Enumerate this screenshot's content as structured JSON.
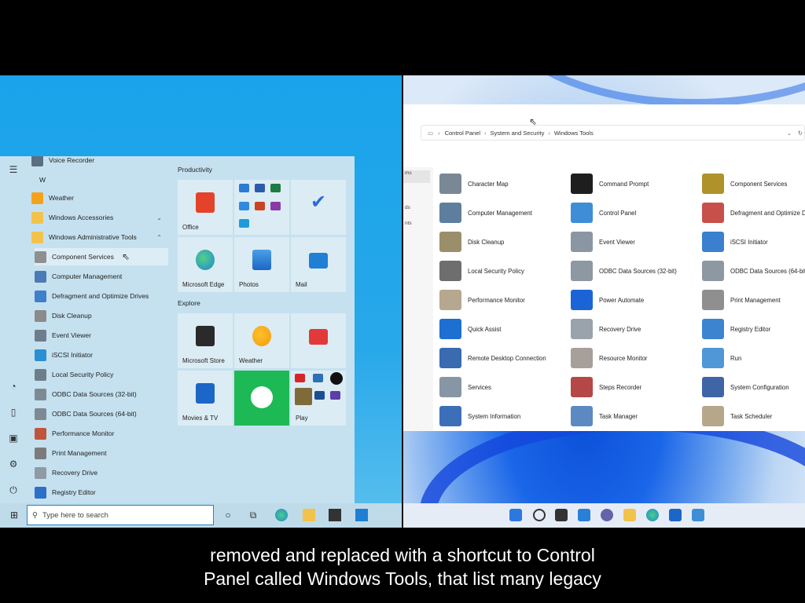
{
  "win10": {
    "app_list": {
      "top_item": "Voice Recorder",
      "letter": "W",
      "items": [
        {
          "label": "Weather",
          "color": "#f3a21c"
        },
        {
          "label": "Windows Accessories",
          "color": "#f2c34b"
        },
        {
          "label": "Windows Administrative Tools",
          "color": "#f2c34b"
        }
      ],
      "admin_tools": [
        {
          "label": "Component Services",
          "color": "#8f8f8f"
        },
        {
          "label": "Computer Management",
          "color": "#4a7bb5"
        },
        {
          "label": "Defragment and Optimize Drives",
          "color": "#3f7fcb"
        },
        {
          "label": "Disk Cleanup",
          "color": "#8b8b8b"
        },
        {
          "label": "Event Viewer",
          "color": "#6e7d8c"
        },
        {
          "label": "iSCSI Initiator",
          "color": "#2c8fd1"
        },
        {
          "label": "Local Security Policy",
          "color": "#6d7e8a"
        },
        {
          "label": "ODBC Data Sources (32-bit)",
          "color": "#7d8a94"
        },
        {
          "label": "ODBC Data Sources (64-bit)",
          "color": "#7d8a94"
        },
        {
          "label": "Performance Monitor",
          "color": "#c0543c"
        },
        {
          "label": "Print Management",
          "color": "#7b7b7b"
        },
        {
          "label": "Recovery Drive",
          "color": "#8e9aa5"
        },
        {
          "label": "Registry Editor",
          "color": "#2e6fc7"
        }
      ]
    },
    "tiles": {
      "group1": "Productivity",
      "group2": "Explore",
      "office": "Office",
      "edge": "Microsoft Edge",
      "photos": "Photos",
      "mail": "Mail",
      "store": "Microsoft Store",
      "weather": "Weather",
      "movies": "Movies & TV",
      "play": "Play"
    },
    "taskbar": {
      "search_placeholder": "Type here to search"
    }
  },
  "win11": {
    "breadcrumb": [
      "Control Panel",
      "System and Security",
      "Windows Tools"
    ],
    "tools": [
      [
        "Character Map",
        "Command Prompt",
        "Component Services"
      ],
      [
        "Computer Management",
        "Control Panel",
        "Defragment and Optimize D"
      ],
      [
        "Disk Cleanup",
        "Event Viewer",
        "iSCSI Initiator"
      ],
      [
        "Local Security Policy",
        "ODBC Data Sources (32-bit)",
        "ODBC Data Sources (64-bit)"
      ],
      [
        "Performance Monitor",
        "Power Automate",
        "Print Management"
      ],
      [
        "Quick Assist",
        "Recovery Drive",
        "Registry Editor"
      ],
      [
        "Remote Desktop Connection",
        "Resource Monitor",
        "Run"
      ],
      [
        "Services",
        "Steps Recorder",
        "System Configuration"
      ],
      [
        "System Information",
        "Task Manager",
        "Task Scheduler"
      ]
    ],
    "tool_colors": [
      [
        "#7a8896",
        "#1e1e1e",
        "#b0922a"
      ],
      [
        "#5e7e9e",
        "#3d8ed6",
        "#c8504a"
      ],
      [
        "#9a8f6a",
        "#8a97a3",
        "#3b7fcf"
      ],
      [
        "#6e6e6e",
        "#8d98a2",
        "#8d98a2"
      ],
      [
        "#b6a88e",
        "#1b64d8",
        "#8f8f8f"
      ],
      [
        "#1d6fd1",
        "#9aa3ab",
        "#3c84d0"
      ],
      [
        "#3a6ab0",
        "#a7a09a",
        "#4f97d6"
      ],
      [
        "#8796a5",
        "#b54747",
        "#3f65a6"
      ],
      [
        "#3c6fb8",
        "#5c89c2",
        "#b6a78a"
      ]
    ],
    "nav": [
      "ms",
      "ds",
      "nts"
    ]
  },
  "caption": {
    "line1": "removed and replaced with a shortcut to Control",
    "line2": "Panel called Windows Tools, that list many legacy"
  }
}
